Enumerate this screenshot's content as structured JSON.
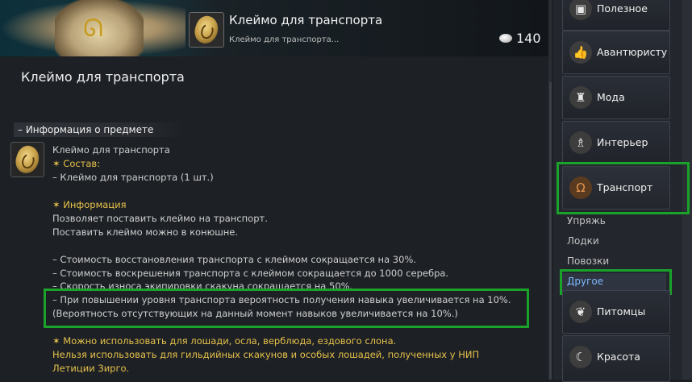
{
  "item": {
    "title": "Клеймо для транспорта",
    "subtitle": "Клеймо для транспорта...",
    "price": "140",
    "heading": "Клеймо для транспорта"
  },
  "info": {
    "section": "– Информация о предмете",
    "lines": [
      "Клеймо для транспорта",
      "✶ Состав:",
      "– Клеймо для транспорта (1 шт.)",
      "✶ Информация",
      "Позволяет поставить клеймо на транспорт.",
      "Поставить клеймо можно в конюшне.",
      "– Стоимость восстановления транспорта с клеймом сокращается на 30%.",
      "– Стоимость воскрешения транспорта с клеймом сокращается до 1000 серебра.",
      "– Скорость износа экипировки скакуна сокращается на 50%.",
      "– При повышении уровня транспорта вероятность получения навыка увеличивается на 10%.",
      "(Вероятность отсутствующих на данный момент навыков увеличивается на 10%.)",
      "✶ Можно использовать для лошади, осла, верблюда, ездового слона.",
      "Нельзя использовать для гильдийных скакунов и особых лошадей, полученных у НИП",
      "Летиции Зирго."
    ]
  },
  "sidebar": {
    "categories": [
      {
        "label": "Полезное",
        "icon": "chest-icon"
      },
      {
        "label": "Авантюристу",
        "icon": "thumbs-up-icon"
      },
      {
        "label": "Мода",
        "icon": "outfit-icon"
      },
      {
        "label": "Интерьер",
        "icon": "chair-icon"
      },
      {
        "label": "Транспорт",
        "icon": "horseshoe-icon"
      },
      {
        "label": "Питомцы",
        "icon": "paw-icon"
      },
      {
        "label": "Красота",
        "icon": "beauty-icon"
      }
    ],
    "subcategories": [
      "Упряжь",
      "Лодки",
      "Повозки",
      "Другое"
    ]
  },
  "colors": {
    "highlight_green": "#1aa22a",
    "gold_text": "#e6c24a",
    "active_sub": "#7db8ff"
  }
}
